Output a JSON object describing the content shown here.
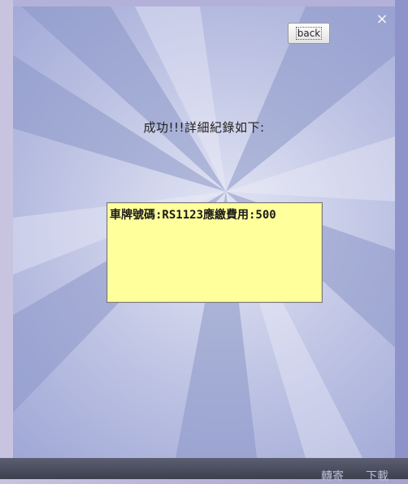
{
  "window": {
    "close_icon": "×",
    "back_label": "back",
    "success_message": "成功!!!詳細紀錄如下:",
    "record_text": "車牌號碼:RS1123應繳費用:500"
  },
  "bottom_bar": {
    "forward_label": "轉寄",
    "download_label": "下載"
  },
  "colors": {
    "record_background": "#ffff9c",
    "bottom_bar": "#4a4c5c"
  }
}
